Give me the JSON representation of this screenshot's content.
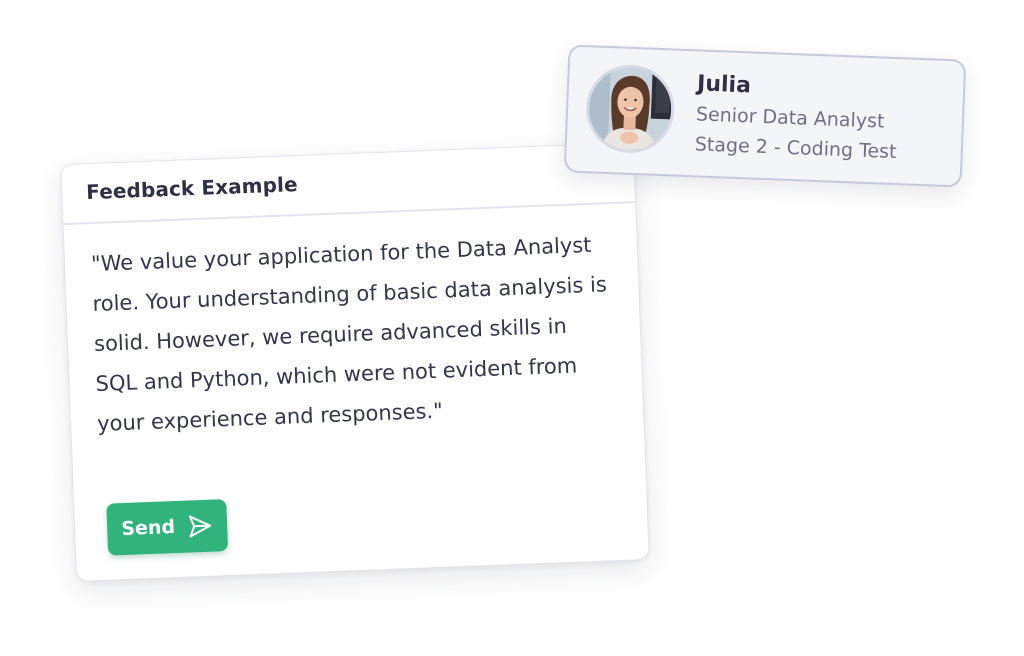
{
  "feedback": {
    "title": "Feedback Example",
    "message": "\"We value your application for the Data Analyst role. Your understanding of basic data analysis is solid. However, we require advanced skills in SQL and Python, which were not evident from your experience and responses.\"",
    "send_label": "Send",
    "send_icon": "paper-plane-icon",
    "accent_color": "#30b47c"
  },
  "candidate": {
    "name": "Julia",
    "role": "Senior Data Analyst",
    "stage": "Stage 2 - Coding Test",
    "avatar_icon": "avatar-photo"
  }
}
